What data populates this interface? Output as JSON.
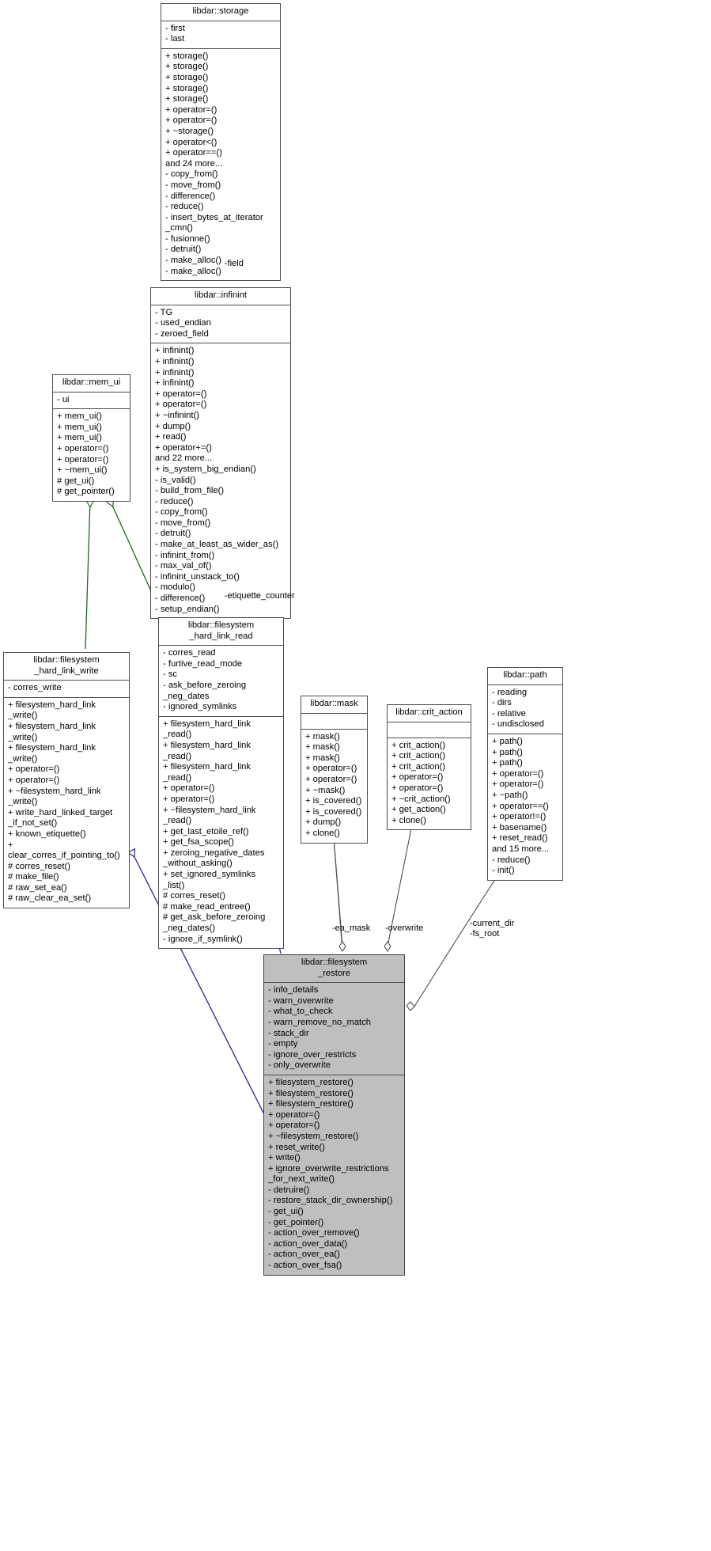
{
  "diagram": {
    "type": "uml-collaboration-diagram",
    "colors": {
      "inheritance_edge": "#1a6b1a",
      "usage_edge": "#26268c",
      "aggregation_edge": "#4d4d4d",
      "node_border": "#4d4d4d",
      "highlight_fill": "#bfbfbf",
      "node_fill": "#ffffff"
    }
  },
  "nodes": {
    "storage": {
      "title": "libdar::storage",
      "attributes": "- first\n- last",
      "operations": "+ storage()\n+ storage()\n+ storage()\n+ storage()\n+ storage()\n+ operator=()\n+ operator=()\n+ ~storage()\n+ operator<()\n+ operator==()\nand 24 more...\n- copy_from()\n- move_from()\n- difference()\n- reduce()\n- insert_bytes_at_iterator\n_cmn()\n- fusionne()\n- detruit()\n- make_alloc()\n- make_alloc()"
    },
    "infinint": {
      "title": "libdar::infinint",
      "attributes": "- TG\n- used_endian\n- zeroed_field",
      "operations": "+ infinint()\n+ infinint()\n+ infinint()\n+ infinint()\n+ operator=()\n+ operator=()\n+ ~infinint()\n+ dump()\n+ read()\n+ operator+=()\nand 22 more...\n+ is_system_big_endian()\n- is_valid()\n- build_from_file()\n- reduce()\n- copy_from()\n- move_from()\n- detruit()\n- make_at_least_as_wider_as()\n- infinint_from()\n- max_val_of()\n- infinint_unstack_to()\n- modulo()\n- difference()\n- setup_endian()"
    },
    "mem_ui": {
      "title": "libdar::mem_ui",
      "attributes": "- ui",
      "operations": "+ mem_ui()\n+ mem_ui()\n+ mem_ui()\n+ operator=()\n+ operator=()\n+ ~mem_ui()\n# get_ui()\n# get_pointer()"
    },
    "filesystem_hard_link_write": {
      "title": "libdar::filesystem\n_hard_link_write",
      "attributes": "- corres_write",
      "operations": "+ filesystem_hard_link\n_write()\n+ filesystem_hard_link\n_write()\n+ filesystem_hard_link\n_write()\n+ operator=()\n+ operator=()\n+ ~filesystem_hard_link\n_write()\n+ write_hard_linked_target\n_if_not_set()\n+ known_etiquette()\n+ clear_corres_if_pointing_to()\n# corres_reset()\n# make_file()\n# raw_set_ea()\n# raw_clear_ea_set()"
    },
    "filesystem_hard_link_read": {
      "title": "libdar::filesystem\n_hard_link_read",
      "attributes": "- corres_read\n- furtive_read_mode\n- sc\n- ask_before_zeroing\n_neg_dates\n- ignored_symlinks",
      "operations": "+ filesystem_hard_link\n_read()\n+ filesystem_hard_link\n_read()\n+ filesystem_hard_link\n_read()\n+ operator=()\n+ operator=()\n+ ~filesystem_hard_link\n_read()\n+ get_last_etoile_ref()\n+ get_fsa_scope()\n+ zeroing_negative_dates\n_without_asking()\n+ set_ignored_symlinks\n_list()\n# corres_reset()\n# make_read_entree()\n# get_ask_before_zeroing\n_neg_dates()\n- ignore_if_symlink()"
    },
    "mask": {
      "title": "libdar::mask",
      "attributes": "",
      "operations": "+ mask()\n+ mask()\n+ mask()\n+ operator=()\n+ operator=()\n+ ~mask()\n+ is_covered()\n+ is_covered()\n+ dump()\n+ clone()"
    },
    "crit_action": {
      "title": "libdar::crit_action",
      "attributes": "",
      "operations": "+ crit_action()\n+ crit_action()\n+ crit_action()\n+ operator=()\n+ operator=()\n+ ~crit_action()\n+ get_action()\n+ clone()"
    },
    "path": {
      "title": "libdar::path",
      "attributes": "- reading\n- dirs\n- relative\n- undisclosed",
      "operations": "+ path()\n+ path()\n+ path()\n+ operator=()\n+ operator=()\n+ ~path()\n+ operator==()\n+ operator!=()\n+ basename()\n+ reset_read()\nand 15 more...\n- reduce()\n- init()"
    },
    "filesystem_restore": {
      "title": "libdar::filesystem\n_restore",
      "attributes": "- info_details\n- warn_overwrite\n- what_to_check\n- warn_remove_no_match\n- stack_dir\n- empty\n- ignore_over_restricts\n- only_overwrite",
      "operations": "+ filesystem_restore()\n+ filesystem_restore()\n+ filesystem_restore()\n+ operator=()\n+ operator=()\n+ ~filesystem_restore()\n+ reset_write()\n+ write()\n+ ignore_overwrite_restrictions\n_for_next_write()\n- detruire()\n- restore_stack_dir_ownership()\n- get_ui()\n- get_pointer()\n- action_over_remove()\n- action_over_data()\n- action_over_ea()\n- action_over_fsa()"
    }
  },
  "edge_labels": {
    "field": "-field",
    "etiquette_counter": "-etiquette_counter",
    "ea_mask": "-ea_mask",
    "overwrite": "-overwrite",
    "current_dir_fs_root": "-current_dir\n-fs_root"
  }
}
